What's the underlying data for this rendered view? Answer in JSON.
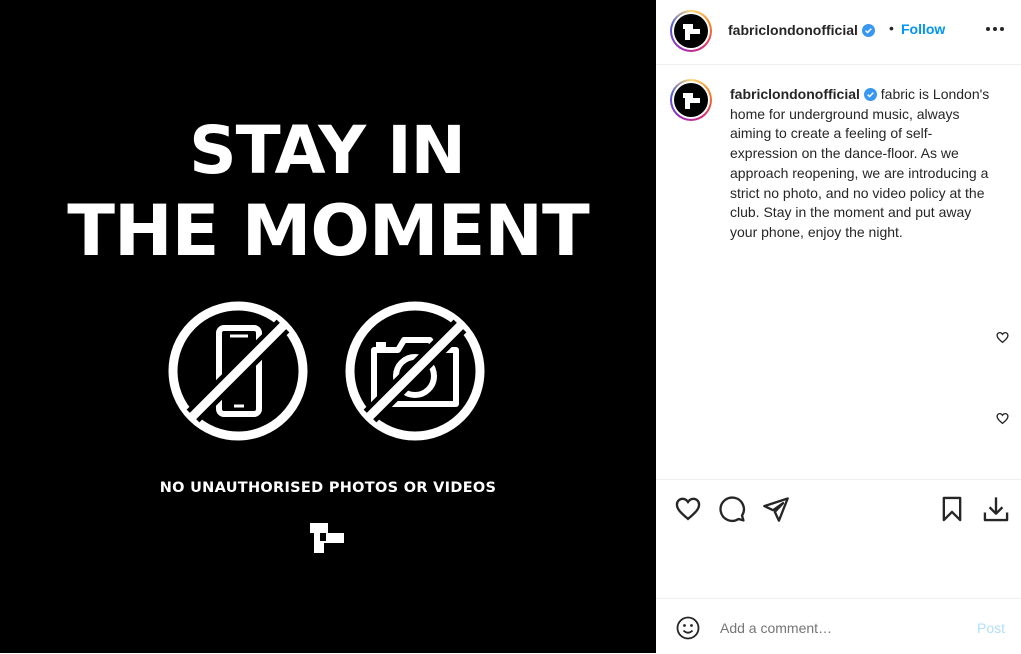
{
  "image": {
    "headline_line1": "STAY IN",
    "headline_line2": "THE MOMENT",
    "disclaimer": "NO UNAUTHORISED PHOTOS OR VIDEOS"
  },
  "header": {
    "username": "fabriclondonofficial",
    "separator": "•",
    "follow_label": "Follow"
  },
  "caption": {
    "username": "fabriclondonofficial",
    "text": "fabric is London's home for underground music, always aiming to create a feeling of self-expression on the dance-floor. As we approach reopening, we are introducing a strict no photo, and no video policy at the club. Stay in the moment and put away your phone, enjoy the night."
  },
  "comment": {
    "placeholder": "Add a comment…",
    "post_label": "Post"
  },
  "icons": [
    "verified-badge-icon",
    "more-options-icon",
    "heart-icon",
    "comment-icon",
    "share-icon",
    "save-icon",
    "download-icon",
    "emoji-icon"
  ],
  "colors": {
    "accent": "#0095f6",
    "post_disabled": "#b2dffc",
    "verified": "#3897f0"
  }
}
